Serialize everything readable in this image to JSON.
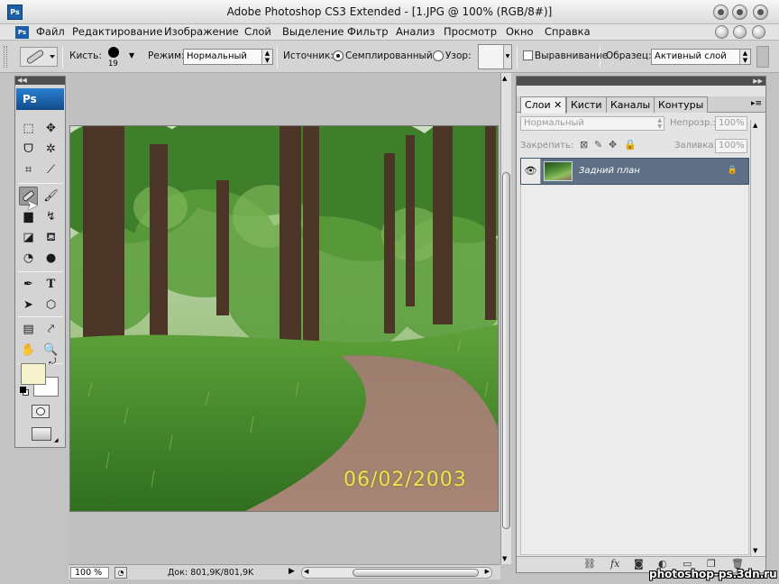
{
  "window": {
    "title": "Adobe Photoshop CS3 Extended - [1.JPG @ 100% (RGB/8#)]",
    "logo_text": "Ps"
  },
  "menu": {
    "items": [
      "Файл",
      "Редактирование",
      "Изображение",
      "Слой",
      "Выделение",
      "Фильтр",
      "Анализ",
      "Просмотр",
      "Окно",
      "Справка"
    ]
  },
  "options": {
    "brush_label": "Кисть:",
    "brush_size": "19",
    "mode_label": "Режим:",
    "mode_value": "Нормальный",
    "source_label": "Источник:",
    "source_sampled": "Семплированный",
    "source_pattern": "Узор:",
    "aligned_label": "Выравнивание",
    "sample_label": "Образец:",
    "sample_value": "Активный слой"
  },
  "toolbox": {
    "logo_text": "Ps"
  },
  "document": {
    "date_stamp": "06/02/2003"
  },
  "status": {
    "zoom": "100 %",
    "doc_size": "Док: 801,9K/801,9K"
  },
  "layers_panel": {
    "tabs": [
      "Слои",
      "Кисти",
      "Каналы",
      "Контуры"
    ],
    "blend_mode": "Нормальный",
    "opacity_label": "Непрозр.:",
    "opacity_value": "100%",
    "lock_label": "Закрепить:",
    "fill_label": "Заливка:",
    "fill_value": "100%",
    "layer_name": "Задний план"
  },
  "watermark": "photoshop-ps.3dn.ru",
  "colors": {
    "foreground": "#f6f3cc",
    "background": "#ffffff",
    "selected_layer": "#5e6f86"
  }
}
